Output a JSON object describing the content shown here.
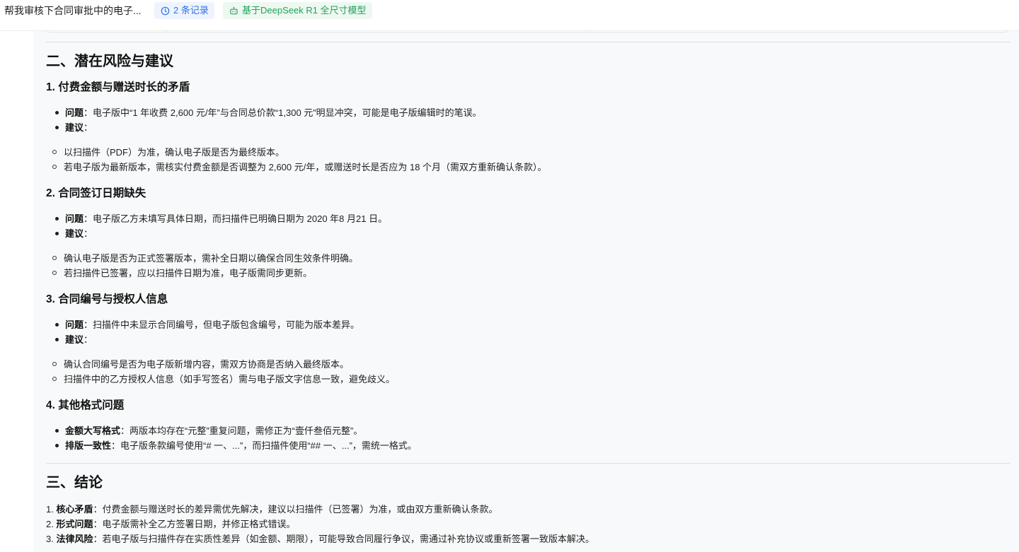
{
  "header": {
    "title": "帮我审核下合同审批中的电子...",
    "records_chip": "2 条记录",
    "model_chip": "基于DeepSeek R1 全尺寸模型"
  },
  "colors": {
    "records_chip_bg": "#eef4fe",
    "records_chip_text": "#2f6fe4",
    "model_chip_bg": "#edf8f1",
    "model_chip_text": "#22a35a",
    "content_bg": "#f8f9fa"
  },
  "icons": {
    "records": "clock-icon",
    "model": "robot-icon"
  },
  "section2": {
    "title": "二、潜在风险与建议",
    "items": [
      {
        "heading": "1. 付费金额与赠送时长的矛盾",
        "issue_label": "问题",
        "issue_text": "：电子版中“1 年收费 2,600 元/年”与合同总价款“1,300 元”明显冲突，可能是电子版编辑时的笔误。",
        "advice_label": "建议",
        "advice_suffix": "：",
        "advice": [
          "以扫描件（PDF）为准，确认电子版是否为最终版本。",
          "若电子版为最新版本，需核实付费金额是否调整为 2,600 元/年，或赠送时长是否应为 18 个月（需双方重新确认条款）。"
        ]
      },
      {
        "heading": "2. 合同签订日期缺失",
        "issue_label": "问题",
        "issue_text": "：电子版乙方未填写具体日期，而扫描件已明确日期为 2020 年8 月21 日。",
        "advice_label": "建议",
        "advice_suffix": "：",
        "advice": [
          "确认电子版是否为正式签署版本，需补全日期以确保合同生效条件明确。",
          "若扫描件已签署，应以扫描件日期为准，电子版需同步更新。"
        ]
      },
      {
        "heading": "3. 合同编号与授权人信息",
        "issue_label": "问题",
        "issue_text": "：扫描件中未显示合同编号，但电子版包含编号，可能为版本差异。",
        "advice_label": "建议",
        "advice_suffix": "：",
        "advice": [
          "确认合同编号是否为电子版新增内容，需双方协商是否纳入最终版本。",
          "扫描件中的乙方授权人信息（如手写签名）需与电子版文字信息一致，避免歧义。"
        ]
      }
    ],
    "item4": {
      "heading": "4. 其他格式问题",
      "points": [
        {
          "label": "金额大写格式",
          "text": "：两版本均存在“元整”重复问题，需修正为“壹仟叁佰元整”。"
        },
        {
          "label": "排版一致性",
          "text": "：电子版条款编号使用“# 一、...”，而扫描件使用“## 一、...”，需统一格式。"
        }
      ]
    }
  },
  "section3": {
    "title": "三、结论",
    "points": [
      {
        "num": "1. ",
        "label": "核心矛盾",
        "text": "：付费金额与赠送时长的差异需优先解决，建议以扫描件（已签署）为准，或由双方重新确认条款。"
      },
      {
        "num": "2. ",
        "label": "形式问题",
        "text": "：电子版需补全乙方签署日期，并修正格式错误。"
      },
      {
        "num": "3. ",
        "label": "法律风险",
        "text": "：若电子版与扫描件存在实质性差异（如金额、期限），可能导致合同履行争议，需通过补充协议或重新签署一致版本解决。"
      }
    ]
  }
}
